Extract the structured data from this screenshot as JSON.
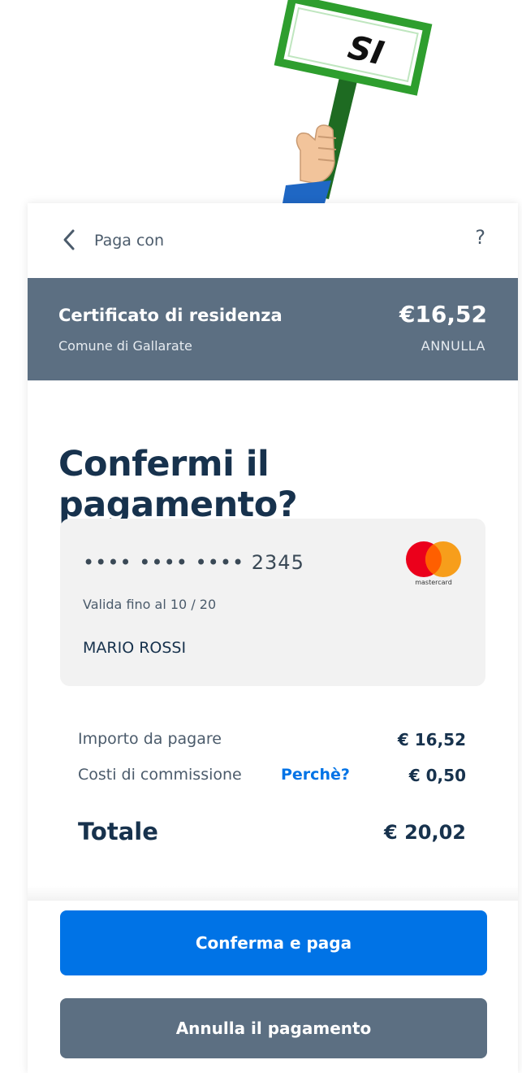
{
  "illustration": {
    "sign_text": "SI"
  },
  "topbar": {
    "title": "Paga con",
    "help_label": "?"
  },
  "payment_header": {
    "title": "Certificato di residenza",
    "subtitle": "Comune di Gallarate",
    "amount": "€16,52",
    "cancel_label": "ANNULLA"
  },
  "main": {
    "title": "Confermi il pagamento?"
  },
  "card": {
    "number": "•••• •••• •••• 2345",
    "expiry": "Valida fino al 10 / 20",
    "holder": "MARIO ROSSI",
    "brand": "mastercard"
  },
  "summary": {
    "amount_label": "Importo da pagare",
    "amount_value": "€ 16,52",
    "fee_label": "Costi di commissione",
    "fee_link": "Perchè?",
    "fee_value": "€ 0,50",
    "total_label": "Totale",
    "total_value": "€ 20,02"
  },
  "actions": {
    "confirm_label": "Conferma e paga",
    "cancel_label": "Annulla il pagamento"
  },
  "colors": {
    "primary": "#0073e6",
    "secondary": "#5c6f82",
    "text_dark": "#17324d",
    "sign_green": "#2e9e2e"
  },
  "icons": {
    "back": "chevron-left-icon",
    "help": "question-mark-icon",
    "card_brand": "mastercard-logo-icon"
  }
}
